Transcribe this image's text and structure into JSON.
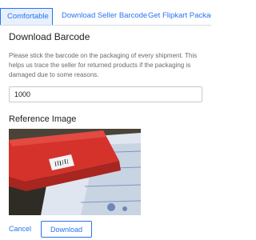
{
  "tabs": [
    {
      "label": "Comfortable",
      "active": true
    },
    {
      "label": "Download Seller Barcode",
      "active": false
    },
    {
      "label": "Get Flipkart Package",
      "active": false
    }
  ],
  "dialog": {
    "title": "Download Barcode",
    "description": "Please stick the barcode on the packaging of every shipment. This helps us trace the seller for returned products if the packaging is damaged due to some reasons.",
    "quantity_value": "1000",
    "reference_title": "Reference Image",
    "cancel_label": "Cancel",
    "download_label": "Download"
  },
  "colors": {
    "accent": "#2874f0",
    "active_tab_bg": "#e8f0fe"
  }
}
